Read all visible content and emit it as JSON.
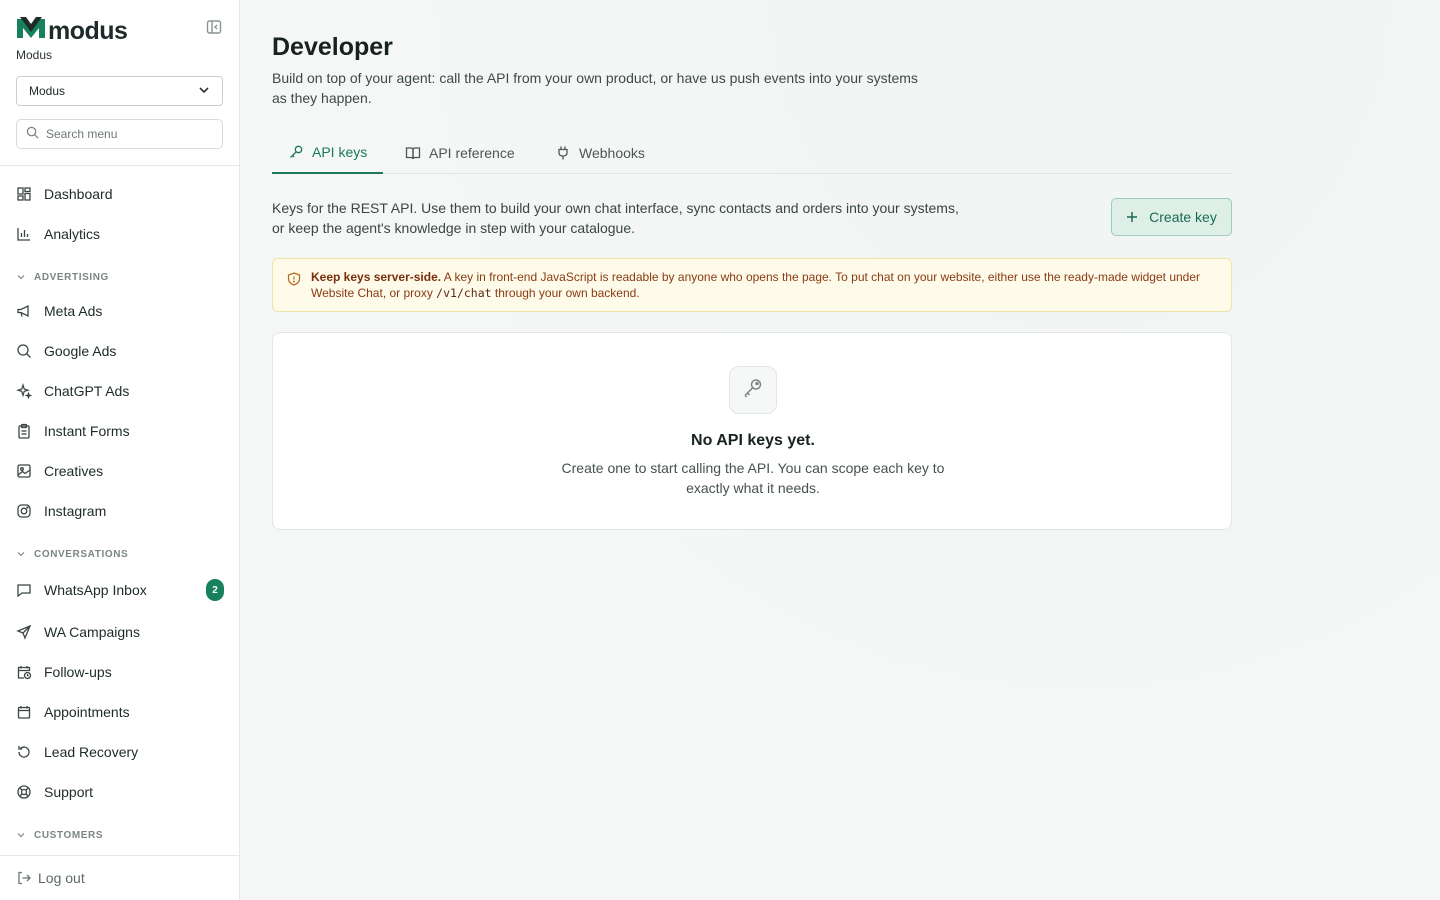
{
  "brand": {
    "name": "modus",
    "org_label": "Modus",
    "accent": "#17805d"
  },
  "sidebar": {
    "org_select": {
      "value": "Modus"
    },
    "search": {
      "placeholder": "Search menu"
    },
    "items": [
      {
        "label": "Dashboard",
        "icon": "dashboard-icon"
      },
      {
        "label": "Analytics",
        "icon": "bar-chart-icon"
      }
    ],
    "sections": [
      {
        "title": "ADVERTISING",
        "items": [
          {
            "label": "Meta Ads",
            "icon": "megaphone-icon"
          },
          {
            "label": "Google Ads",
            "icon": "search-icon"
          },
          {
            "label": "ChatGPT Ads",
            "icon": "sparkles-icon"
          },
          {
            "label": "Instant Forms",
            "icon": "clipboard-icon"
          },
          {
            "label": "Creatives",
            "icon": "image-icon"
          },
          {
            "label": "Instagram",
            "icon": "instagram-icon"
          }
        ]
      },
      {
        "title": "CONVERSATIONS",
        "items": [
          {
            "label": "WhatsApp Inbox",
            "icon": "chat-icon",
            "badge": "2"
          },
          {
            "label": "WA Campaigns",
            "icon": "send-icon"
          },
          {
            "label": "Follow-ups",
            "icon": "calendar-clock-icon"
          },
          {
            "label": "Appointments",
            "icon": "calendar-icon"
          },
          {
            "label": "Lead Recovery",
            "icon": "rotate-icon"
          },
          {
            "label": "Support",
            "icon": "lifebuoy-icon"
          }
        ]
      },
      {
        "title": "CUSTOMERS",
        "items": []
      }
    ],
    "logout_label": "Log out"
  },
  "page": {
    "title": "Developer",
    "subtitle": "Build on top of your agent: call the API from your own product, or have us push events into your systems as they happen.",
    "tabs": [
      {
        "label": "API keys",
        "icon": "key-icon",
        "active": true
      },
      {
        "label": "API reference",
        "icon": "book-icon",
        "active": false
      },
      {
        "label": "Webhooks",
        "icon": "plug-icon",
        "active": false
      }
    ],
    "intro": "Keys for the REST API. Use them to build your own chat interface, sync contacts and orders into your systems, or keep the agent's knowledge in step with your catalogue.",
    "create_button": "Create key",
    "warning": {
      "bold": "Keep keys server-side.",
      "text_before_code": " A key in front-end JavaScript is readable by anyone who opens the page. To put chat on your website, either use the ready-made widget under Website Chat, or proxy ",
      "code": "/v1/chat",
      "text_after_code": " through your own backend."
    },
    "empty_state": {
      "title": "No API keys yet.",
      "description": "Create one to start calling the API. You can scope each key to exactly what it needs."
    }
  }
}
